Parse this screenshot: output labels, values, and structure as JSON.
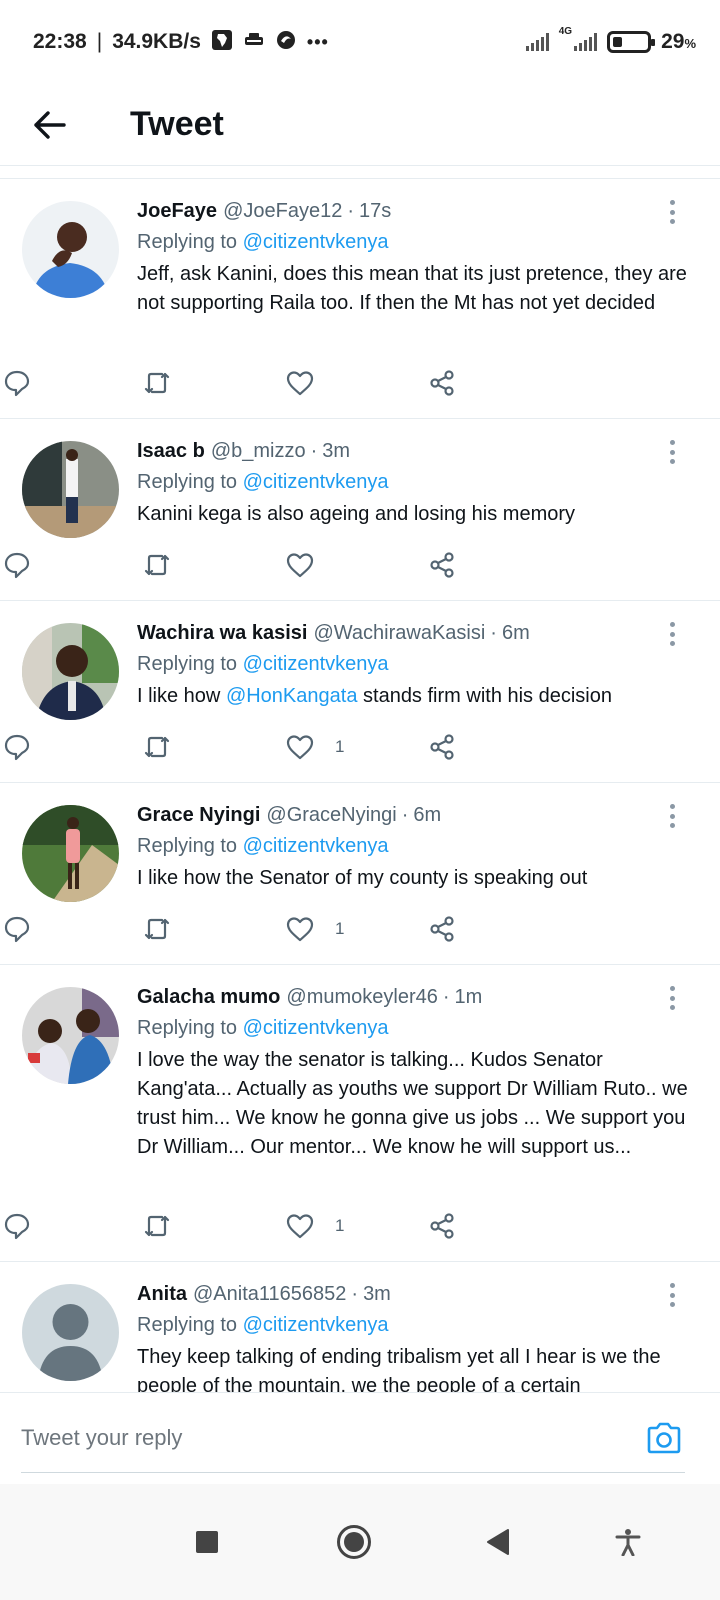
{
  "status_bar": {
    "time": "22:38",
    "speed": "34.9KB/s",
    "more": "•••",
    "network": "4G",
    "battery_level": 29,
    "battery_value": "29",
    "battery_unit": "%"
  },
  "header": {
    "title": "Tweet"
  },
  "colors": {
    "link": "#1d9bf0",
    "secondary_text": "#536471",
    "primary_text": "#0f1419"
  },
  "replying_prefix": "Replying to",
  "tweets": [
    {
      "name": "JoeFaye",
      "handle": "@JoeFaye12",
      "time": "17s",
      "reply_to": "@citizentvkenya",
      "text": "Jeff, ask Kanini, does this mean that its just pretence, they are not supporting Raila too. If then the Mt has not yet decided",
      "likes": ""
    },
    {
      "name": "Isaac b",
      "handle": "@b_mizzo",
      "time": "3m",
      "reply_to": "@citizentvkenya",
      "text": "Kanini kega is also ageing and losing his memory",
      "likes": ""
    },
    {
      "name": "Wachira wa kasisi",
      "handle": "@WachirawaKasisi",
      "time": "6m",
      "reply_to": "@citizentvkenya",
      "text_before": "I like how ",
      "text_mention": "@HonKangata",
      "text_after": " stands firm with his decision",
      "likes": "1"
    },
    {
      "name": "Grace Nyingi",
      "handle": "@GraceNyingi",
      "time": "6m",
      "reply_to": "@citizentvkenya",
      "text": "I like how the Senator of my county is speaking out",
      "likes": "1"
    },
    {
      "name": "Galacha mumo",
      "handle": "@mumokeyler46",
      "time": "1m",
      "reply_to": "@citizentvkenya",
      "text": "I love the way the senator is talking... Kudos Senator Kang'ata... Actually as youths we support Dr William Ruto.. we trust him... We know he gonna give us jobs ... We support you Dr William... Our mentor... We know he will support us...",
      "likes": "1"
    },
    {
      "name": "Anita",
      "handle": "@Anita11656852",
      "time": "3m",
      "reply_to": "@citizentvkenya",
      "text": "They keep talking of ending tribalism yet all I hear is we the people of the mountain, we the people of a certain",
      "likes": ""
    }
  ],
  "composer": {
    "placeholder": "Tweet your reply"
  }
}
